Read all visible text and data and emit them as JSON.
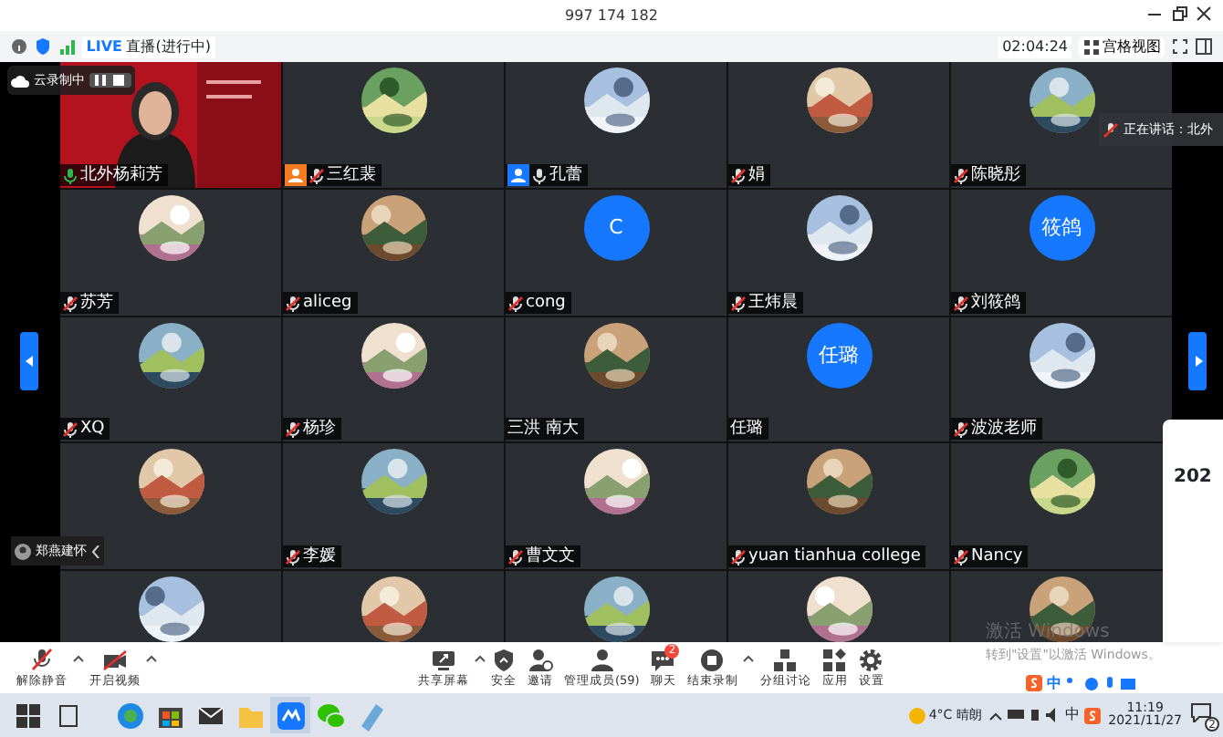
{
  "window": {
    "title": "997 174 182"
  },
  "top_bar": {
    "live_badge": "LIVE",
    "live_status": "直播(进行中)",
    "timer": "02:04:24",
    "view_button": "宫格视图"
  },
  "recording": {
    "label": "云录制中"
  },
  "speaking_notice": "正在讲话：北外",
  "participants": [
    {
      "name": "北外杨莉芳",
      "kind": "video",
      "muted": false,
      "speaking": true
    },
    {
      "name": "三红裴",
      "kind": "picture",
      "muted": true,
      "color": "#f47b20"
    },
    {
      "name": "孔蕾",
      "kind": "picture",
      "muted": false,
      "color": "#1677ff"
    },
    {
      "name": "娟",
      "kind": "picture",
      "muted": true
    },
    {
      "name": "陈晓彤",
      "kind": "picture",
      "muted": true
    },
    {
      "name": "苏芳",
      "kind": "picture",
      "muted": true
    },
    {
      "name": "aliceg",
      "kind": "picture",
      "muted": true
    },
    {
      "name": "cong",
      "kind": "letter",
      "initials": "C",
      "muted": true
    },
    {
      "name": "王炜晨",
      "kind": "picture",
      "muted": true
    },
    {
      "name": "刘筱鸽",
      "kind": "letter",
      "initials": "筱鸽",
      "muted": true
    },
    {
      "name": "XQ",
      "kind": "picture",
      "muted": true
    },
    {
      "name": "杨珍",
      "kind": "picture",
      "muted": true
    },
    {
      "name": "三洪 南大",
      "kind": "picture"
    },
    {
      "name": "任璐",
      "kind": "letter",
      "initials": "任璐"
    },
    {
      "name": "波波老师",
      "kind": "picture",
      "muted": true
    },
    {
      "kind": "picture"
    },
    {
      "name": "李媛",
      "kind": "picture",
      "muted": true
    },
    {
      "name": "曹文文",
      "kind": "picture",
      "muted": true
    },
    {
      "name": "yuan tianhua college",
      "kind": "picture",
      "muted": true
    },
    {
      "name": "Nancy",
      "kind": "picture",
      "muted": true
    },
    {
      "kind": "picture"
    },
    {
      "kind": "picture"
    },
    {
      "kind": "picture"
    },
    {
      "kind": "picture"
    },
    {
      "kind": "picture"
    }
  ],
  "minimized_chip": "郑燕建怀",
  "side_panel": {
    "title": "202"
  },
  "input_method_bar": {
    "mode": "中"
  },
  "activation_notice": [
    "激活 Windows",
    "转到\"设置\"以激活 Windows。"
  ],
  "toolbar": {
    "left": [
      {
        "label": "解除静音",
        "caret": true
      },
      {
        "label": "开启视频",
        "caret": true
      }
    ],
    "center": [
      {
        "label": "共享屏幕",
        "caret": true
      },
      {
        "label": "安全",
        "caret": false
      },
      {
        "label": "邀请",
        "caret": false
      },
      {
        "label": "管理成员(59)",
        "caret": false
      },
      {
        "label": "聊天",
        "badge": "2",
        "caret": false
      },
      {
        "label": "结束录制",
        "caret": true
      },
      {
        "label": "分组讨论",
        "caret": false
      },
      {
        "label": "应用",
        "caret": false
      },
      {
        "label": "设置",
        "caret": false
      }
    ]
  },
  "taskbar": {
    "weather": "4°C 晴朗",
    "ime": "中",
    "time": "11:19",
    "date": "2021/11/27",
    "notifications": "2"
  }
}
